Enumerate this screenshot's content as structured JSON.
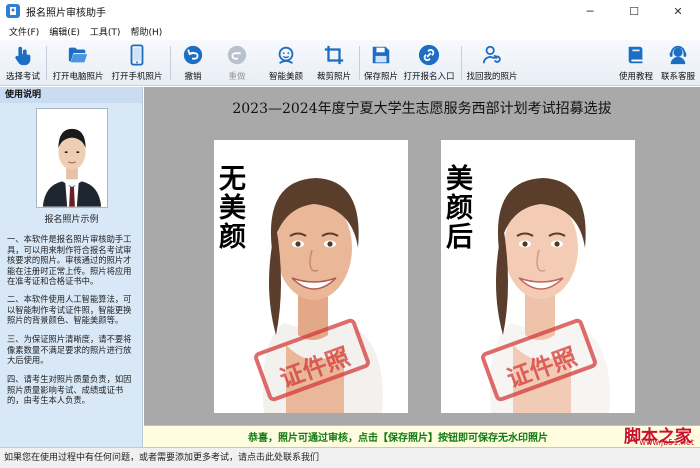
{
  "window": {
    "title": "报名照片审核助手",
    "minimize": "─",
    "maximize": "☐",
    "close": "✕"
  },
  "menu": [
    "文件(F)",
    "编辑(E)",
    "工具(T)",
    "帮助(H)"
  ],
  "toolbar": [
    {
      "label": "选择考试",
      "icon": "hand-pointer-icon"
    },
    {
      "label": "打开电脑照片",
      "icon": "folder-open-icon"
    },
    {
      "label": "打开手机照片",
      "icon": "mobile-phone-icon"
    },
    {
      "label": "撤销",
      "icon": "undo-icon"
    },
    {
      "label": "重做",
      "icon": "redo-icon"
    },
    {
      "label": "智能美颜",
      "icon": "face-beauty-icon"
    },
    {
      "label": "裁剪照片",
      "icon": "crop-icon"
    },
    {
      "label": "保存照片",
      "icon": "save-icon"
    },
    {
      "label": "打开报名入口",
      "icon": "link-icon"
    },
    {
      "label": "找回我的照片",
      "icon": "user-refresh-icon"
    },
    {
      "label": "使用教程",
      "icon": "book-icon"
    },
    {
      "label": "联系客服",
      "icon": "support-agent-icon"
    }
  ],
  "sidebar": {
    "header": "使用说明",
    "photo_caption": "报名照片示例",
    "paragraphs": [
      "一、本软件是报名照片审核助手工具，可以用来制作符合报名考试审核要求的照片。审核通过的照片才能在注册时正常上传。照片将应用在准考证和合格证书中。",
      "二、本软件使用人工智能算法，可以智能制作考试证件照，智能更换照片的背景颜色、智能美颜等。",
      "三、为保证照片清晰度，请不要将像素数量不满足要求的照片进行放大后使用。",
      "四、请考生对照片质量负责，如因照片质量影响考试、成绩或证书的，由考生本人负责。"
    ]
  },
  "main": {
    "title": "2023—2024年度宁夏大学生志愿服务西部计划考试招募选拔",
    "before_label": "无美颜",
    "after_label": "美颜后",
    "stamp_text": "证件照"
  },
  "status": {
    "message": "恭喜，照片可通过审核，点击【保存照片】按钮即可保存无水印照片",
    "watermark": "脚本之家",
    "watermark_url": "www.jb51.net"
  },
  "footer": {
    "text": "如果您在使用过程中有任何问题，或者需要添加更多考试，请点击此处联系我们"
  },
  "colors": {
    "accent": "#2f7fd8",
    "status_green": "#117a11",
    "watermark_red": "#c8102e",
    "stamp_red": "#d43a3a"
  }
}
